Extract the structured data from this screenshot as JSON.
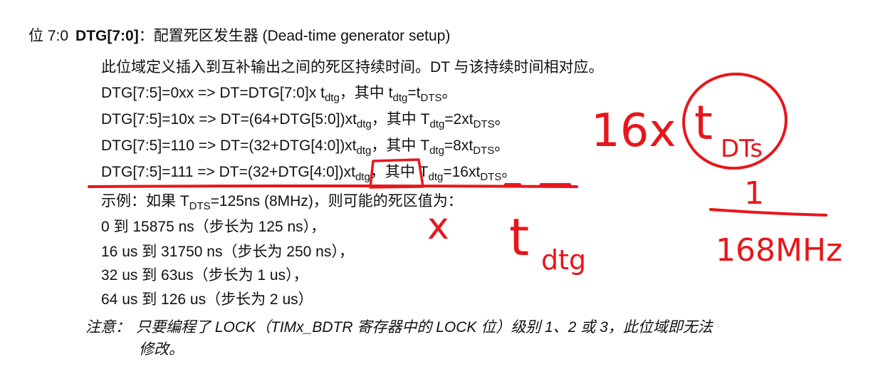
{
  "heading": {
    "bit_position": "位 7:0",
    "field_name": "DTG[7:0]",
    "title": "：配置死区发生器 (Dead-time generator setup)"
  },
  "description": "此位域定义插入到互补输出之间的死区持续时间。DT 与该持续时间相对应。",
  "formulas": [
    {
      "pre": "DTG[7:5]=0xx => DT=DTG[7:0]x t",
      "sub1": "dtg",
      "mid": "，其中 t",
      "sub2": "dtg",
      "eq": "=t",
      "sub3": "DTS",
      "end": "。"
    },
    {
      "pre": "DTG[7:5]=10x => DT=(64+DTG[5:0])xt",
      "sub1": "dtg",
      "mid": "，其中 T",
      "sub2": "dtg",
      "eq": "=2xt",
      "sub3": "DTS",
      "end": "。"
    },
    {
      "pre": "DTG[7:5]=110 => DT=(32+DTG[4:0])xt",
      "sub1": "dtg",
      "mid": "，其中 T",
      "sub2": "dtg",
      "eq": "=8xt",
      "sub3": "DTS",
      "end": "。"
    },
    {
      "pre": "DTG[7:5]=111 => DT=(32+DTG[4:0])xt",
      "sub1": "dtg",
      "mid": "，其中 T",
      "sub2": "dtg",
      "eq": "=16xt",
      "sub3": "DTS",
      "end": "。"
    }
  ],
  "example": {
    "pre": "示例：如果 T",
    "sub": "DTS",
    "post": "=125ns (8MHz)，则可能的死区值为："
  },
  "ranges": [
    "0 到 15875 ns（步长为 125 ns），",
    "16 us 到 31750 ns（步长为 250 ns），",
    "32 us 到 63us（步长为 1 us），",
    "64 us 到 126 us（步长为 2 us）"
  ],
  "note": {
    "label": "注意：",
    "text": "只要编程了 LOCK（TIMx_BDTR 寄存器中的 LOCK 位）级别 1、2 或 3，此位域即无法",
    "continuation": "修改。"
  },
  "handwriting": {
    "multiplier": "16x",
    "circled_main": "t",
    "circled_sub": "DTs",
    "numerator": "1",
    "denominator": "168MHz",
    "times_mark": "x",
    "tdtg_main": "t",
    "tdtg_sub": "dtg"
  },
  "ink_color": "#e8161b"
}
